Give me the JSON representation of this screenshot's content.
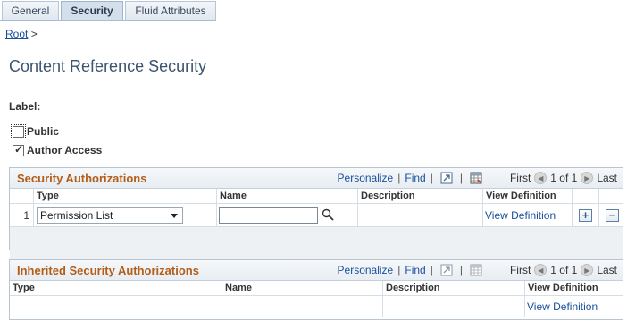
{
  "tabs": [
    {
      "label": "General"
    },
    {
      "label": "Security"
    },
    {
      "label": "Fluid Attributes"
    }
  ],
  "breadcrumb": {
    "root": "Root",
    "sep": ">"
  },
  "page_title": "Content Reference Security",
  "label_heading": "Label:",
  "checkboxes": {
    "public": {
      "label": "Public",
      "checked": false
    },
    "author_access": {
      "label": "Author Access",
      "checked": true
    }
  },
  "grid_nav": {
    "personalize": "Personalize",
    "find": "Find",
    "first": "First",
    "page_info": "1 of 1",
    "last": "Last",
    "sep": "|"
  },
  "security_grid": {
    "title": "Security Authorizations",
    "columns": [
      "Type",
      "Name",
      "Description",
      "View Definition"
    ],
    "rows": [
      {
        "num": "1",
        "type": "Permission List",
        "name": "",
        "description": "",
        "view_definition": "View Definition",
        "add": "+",
        "remove": "−"
      }
    ]
  },
  "inherited_grid": {
    "title": "Inherited Security Authorizations",
    "columns": [
      "Type",
      "Name",
      "Description",
      "View Definition"
    ],
    "rows": [
      {
        "view_definition": "View Definition"
      }
    ]
  }
}
